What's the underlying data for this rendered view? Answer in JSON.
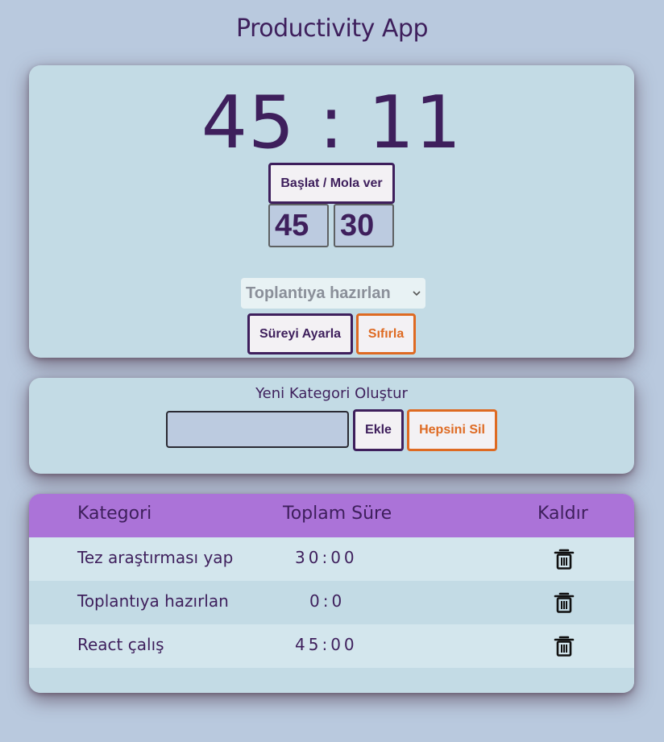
{
  "app": {
    "title": "Productivity App"
  },
  "timer": {
    "display": "45 : 11",
    "start_pause_label": "Başlat / Mola ver",
    "minutes_value": "45",
    "seconds_value": "30",
    "task_select_value": "Toplantıya hazırlan",
    "set_label": "Süreyi Ayarla",
    "reset_label": "Sıfırla"
  },
  "category_form": {
    "heading": "Yeni Kategori Oluştur",
    "input_value": "",
    "add_label": "Ekle",
    "clear_all_label": "Hepsini Sil"
  },
  "table": {
    "headers": {
      "category": "Kategori",
      "total_time": "Toplam Süre",
      "remove": "Kaldır"
    },
    "rows": [
      {
        "category": "Tez araştırması yap",
        "total_time": "30:00"
      },
      {
        "category": "Toplantıya hazırlan",
        "total_time": "0:0"
      },
      {
        "category": "React çalış",
        "total_time": "45:00"
      }
    ]
  },
  "colors": {
    "background": "#b9c9de",
    "card": "#c3dbe5",
    "accent_text": "#3e1f5c",
    "table_header": "#ab73d8",
    "danger_orange": "#de6a22"
  },
  "icons": {
    "remove": "trash-icon",
    "select": "chevron-down-icon"
  }
}
